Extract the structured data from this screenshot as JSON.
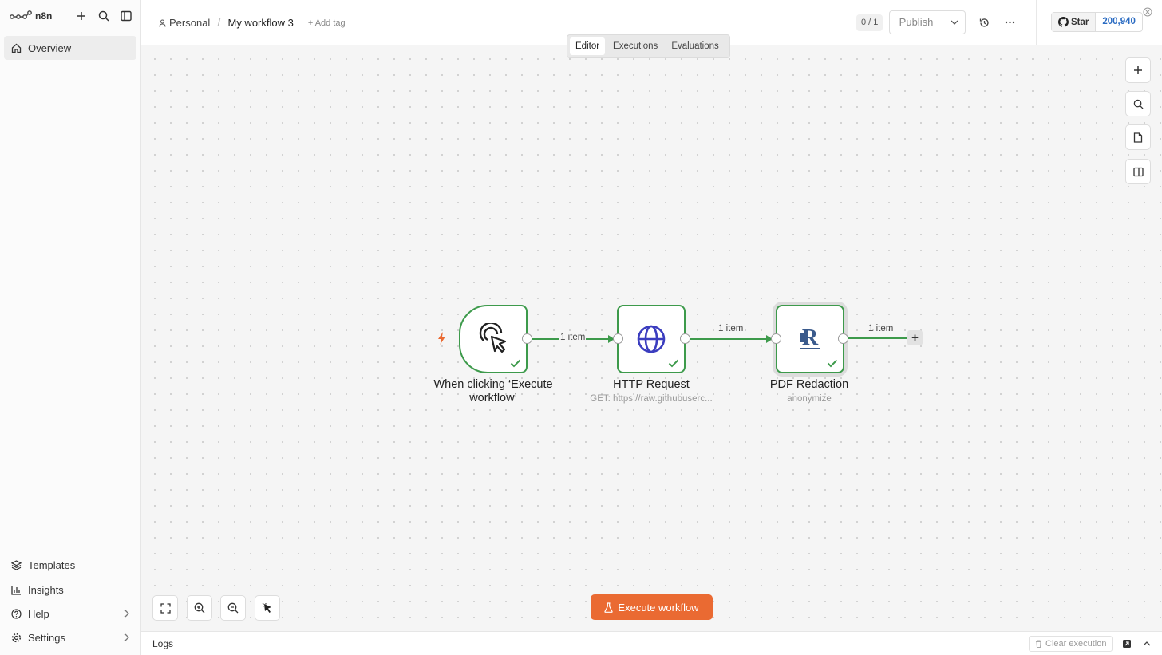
{
  "app": {
    "name": "n8n"
  },
  "sidebar": {
    "top": [
      {
        "label": "Overview",
        "icon": "home-icon"
      }
    ],
    "bottom": [
      {
        "label": "Templates",
        "icon": "templates-icon"
      },
      {
        "label": "Insights",
        "icon": "insights-icon"
      },
      {
        "label": "Help",
        "icon": "help-icon"
      },
      {
        "label": "Settings",
        "icon": "settings-icon"
      }
    ]
  },
  "header": {
    "project": "Personal",
    "workflow_name": "My workflow 3",
    "add_tag": "+ Add tag",
    "counter": "0 / 1",
    "publish_label": "Publish",
    "github": {
      "star_label": "Star",
      "count": "200,940"
    }
  },
  "tabs": [
    {
      "label": "Editor",
      "active": true
    },
    {
      "label": "Executions",
      "active": false
    },
    {
      "label": "Evaluations",
      "active": false
    }
  ],
  "nodes": [
    {
      "title": "When clicking ‘Execute workflow’",
      "subtitle": "",
      "icon": "cursor-click-icon",
      "status": "success"
    },
    {
      "title": "HTTP Request",
      "subtitle": "GET: https://raw.githubuserc...",
      "icon": "globe-icon",
      "status": "success"
    },
    {
      "title": "PDF Redaction",
      "subtitle": "anonymize",
      "icon": "redaction-logo",
      "status": "success"
    }
  ],
  "edges": [
    {
      "label": "1 item"
    },
    {
      "label": "1 item"
    },
    {
      "label": "1 item"
    }
  ],
  "execute_button": "Execute workflow",
  "logs": {
    "title": "Logs",
    "clear_label": "Clear execution"
  },
  "colors": {
    "accent": "#ea6a32",
    "success": "#3d9a4b",
    "link": "#2a6bc2"
  }
}
